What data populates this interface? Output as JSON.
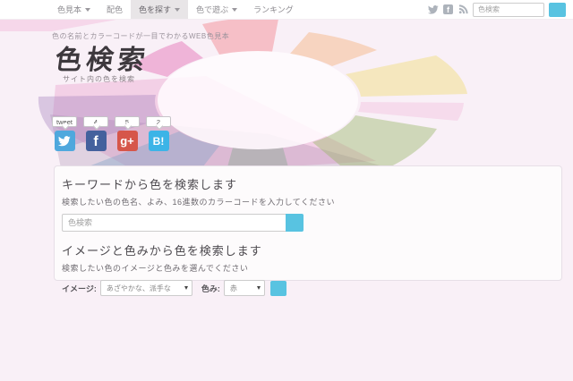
{
  "navbar": {
    "items": [
      {
        "label": "色見本",
        "caret": true,
        "active": false
      },
      {
        "label": "配色",
        "caret": false,
        "active": false
      },
      {
        "label": "色を探す",
        "caret": true,
        "active": true
      },
      {
        "label": "色で遊ぶ",
        "caret": true,
        "active": false
      },
      {
        "label": "ランキング",
        "caret": false,
        "active": false
      }
    ],
    "social_icons": [
      "twitter",
      "facebook",
      "rss"
    ],
    "search": {
      "placeholder": "色検索"
    }
  },
  "header": {
    "tagline": "色の名前とカラーコードが一目でわかるWEB色見本",
    "title": "色検索",
    "subtitle": "サイト内の色を検索"
  },
  "pinwheel": {
    "big_pink": "rgba(236,160,205,0.40)",
    "mauve": "rgba(150,120,160,0.25)",
    "top_band": "rgba(240,170,210,0.35)",
    "center_color": "rgba(255,251,254,0.85)",
    "petals": [
      {
        "name": "pink",
        "color": "rgba(230,120,185,0.50)"
      },
      {
        "name": "salmon",
        "color": "rgba(242,130,140,0.45)"
      },
      {
        "name": "peach",
        "color": "rgba(245,170,110,0.40)"
      },
      {
        "name": "yellow",
        "color": "rgba(240,220,120,0.45)"
      },
      {
        "name": "pale-pink",
        "color": "rgba(240,180,215,0.35)"
      },
      {
        "name": "green",
        "color": "rgba(150,180,100,0.42)"
      },
      {
        "name": "gray-green",
        "color": "rgba(140,170,150,0.45)"
      },
      {
        "name": "blue-gray",
        "color": "rgba(130,165,200,0.42)"
      },
      {
        "name": "lavender",
        "color": "rgba(165,130,190,0.38)"
      }
    ]
  },
  "share": {
    "buttons": [
      {
        "network": "twitter",
        "count_label": "tweet",
        "glyph": "",
        "color": "#4fa8dd"
      },
      {
        "network": "facebook",
        "count_label": "4",
        "glyph": "f",
        "color": "#44619d"
      },
      {
        "network": "googleplus",
        "count_label": "5",
        "glyph": "g+",
        "color": "#d6564a"
      },
      {
        "network": "hatena",
        "count_label": "2",
        "glyph": "B!",
        "color": "#3cb4e7"
      }
    ]
  },
  "keyword_search": {
    "heading": "キーワードから色を検索します",
    "description": "検索したい色の色名、よみ、16進数のカラーコードを入力してください",
    "input_placeholder": "色検索"
  },
  "image_search": {
    "heading": "イメージと色みから色を検索します",
    "description": "検索したい色のイメージと色みを選んでください",
    "image_label": "イメージ:",
    "image_value": "あざやかな、派手な",
    "tone_label": "色み:",
    "tone_value": "赤"
  },
  "colors": {
    "accent_button": "#58c3e1",
    "page_background": "#f9f0f7",
    "navbar_background": "#ffffff",
    "nav_active_background": "#e8e5e7",
    "card_background": "#fdfbfc",
    "card_border": "#e7dfe7"
  }
}
